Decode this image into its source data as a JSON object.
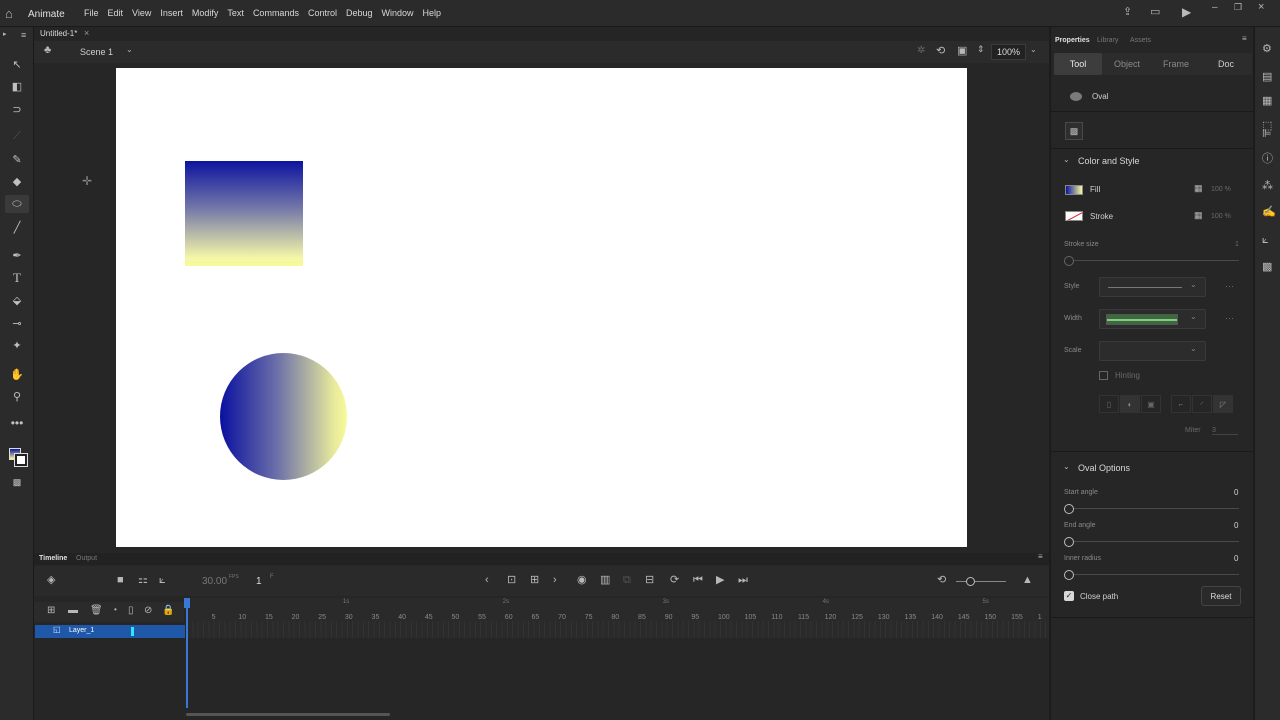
{
  "app": {
    "name": "Animate"
  },
  "menu": [
    "File",
    "Edit",
    "View",
    "Insert",
    "Modify",
    "Text",
    "Commands",
    "Control",
    "Debug",
    "Window",
    "Help"
  ],
  "document": {
    "tab_title": "Untitled-1*",
    "close": "×"
  },
  "scene": {
    "name": "Scene 1",
    "zoom": "100%"
  },
  "panel_tabs": {
    "properties": "Properties",
    "library": "Library",
    "assets": "Assets"
  },
  "prop_tabs": {
    "tool": "Tool",
    "object": "Object",
    "frame": "Frame",
    "doc": "Doc"
  },
  "tool_name": "Oval",
  "color_style": {
    "header": "Color and Style",
    "fill_label": "Fill",
    "fill_alpha": "100 %",
    "stroke_label": "Stroke",
    "stroke_alpha": "100 %",
    "stroke_size_label": "Stroke size",
    "stroke_size_value": "1",
    "style_label": "Style",
    "width_label": "Width",
    "scale_label": "Scale",
    "hinting_label": "Hinting",
    "miter_label": "Miter",
    "miter_value": "3"
  },
  "oval_options": {
    "header": "Oval Options",
    "start_angle_label": "Start angle",
    "start_angle_value": "0",
    "end_angle_label": "End angle",
    "end_angle_value": "0",
    "inner_radius_label": "Inner radius",
    "inner_radius_value": "0",
    "close_path_label": "Close path",
    "reset_label": "Reset"
  },
  "timeline": {
    "tab_timeline": "Timeline",
    "tab_output": "Output",
    "fps": "30.00",
    "fps_unit": "FPS",
    "frame": "1",
    "frame_unit": "F",
    "layer_name": "Layer_1",
    "ruler": [
      "5",
      "10",
      "15",
      "20",
      "25",
      "30",
      "35",
      "40",
      "45",
      "50",
      "55",
      "60",
      "65",
      "70",
      "75",
      "80",
      "85",
      "90",
      "95",
      "100",
      "105",
      "110",
      "115",
      "120",
      "125",
      "130",
      "135",
      "140",
      "145",
      "150",
      "155",
      "1"
    ],
    "seconds": [
      "1s",
      "2s",
      "3s",
      "4s",
      "5s"
    ]
  },
  "colors": {
    "accent": "#1f58a8",
    "fill_gradient_start": "#0c14a0",
    "fill_gradient_end": "#f8fa98"
  }
}
